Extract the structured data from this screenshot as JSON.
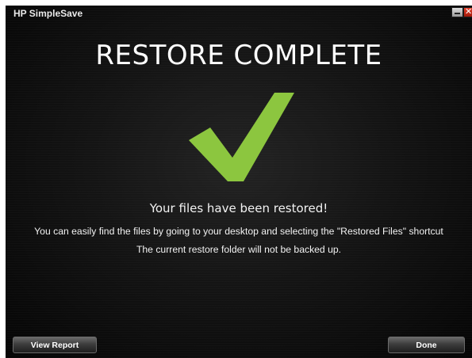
{
  "window": {
    "title": "HP SimpleSave",
    "minimize_glyph": "",
    "close_glyph": "✕"
  },
  "main": {
    "headline": "RESTORE COMPLETE",
    "message": "Your files have been restored!",
    "detail_line_1": "You can easily find the files by going to your desktop and selecting the \"Restored Files\" shortcut",
    "detail_line_2": "The current restore folder will not be backed up."
  },
  "footer": {
    "view_report_label": "View Report",
    "done_label": "Done"
  },
  "icons": {
    "checkmark": "checkmark-icon"
  },
  "colors": {
    "checkmark": "#8cc63f",
    "background": "#141414",
    "close_button": "#c8260f"
  }
}
